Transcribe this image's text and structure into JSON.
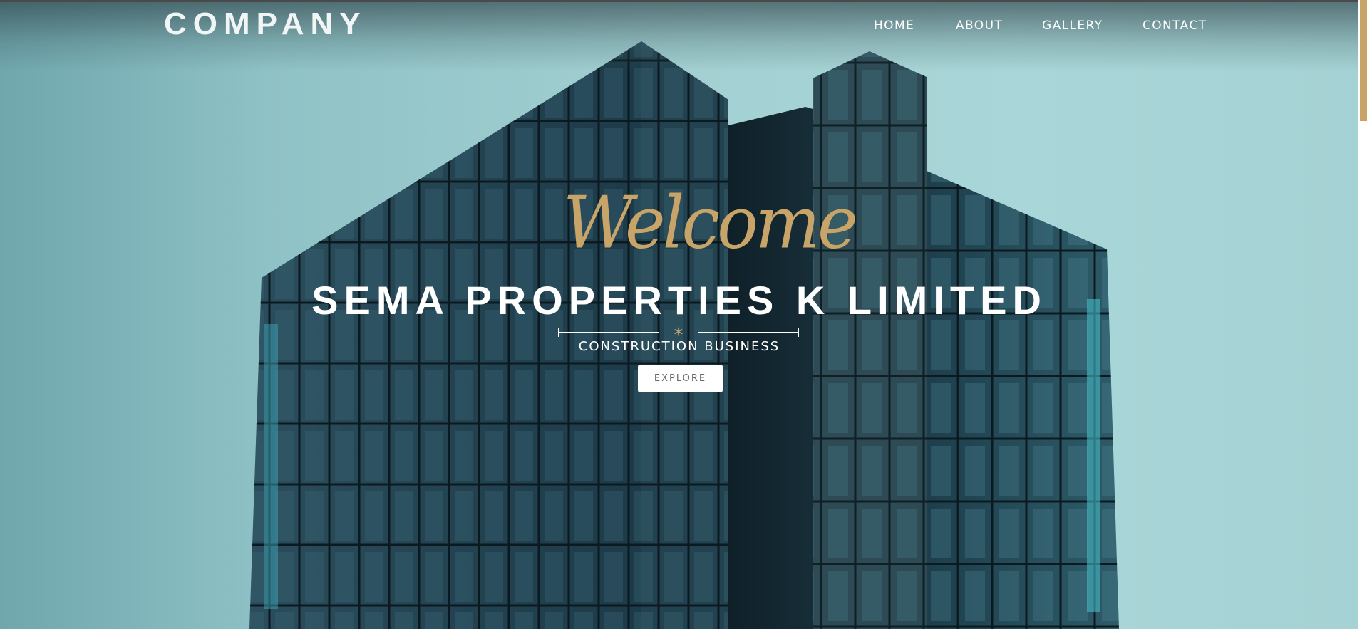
{
  "header": {
    "logo_text": "COMPANY",
    "nav": [
      {
        "label": "HOME"
      },
      {
        "label": "ABOUT"
      },
      {
        "label": "GALLERY"
      },
      {
        "label": "CONTACT"
      }
    ]
  },
  "hero": {
    "welcome": "Welcome",
    "title": "SEMA PROPERTIES K LIMITED",
    "divider_symbol": "*",
    "subtitle": "CONSTRUCTION BUSINESS",
    "cta_label": "EXPLORE"
  },
  "colors": {
    "accent_gold": "#c9a468",
    "sky_teal": "#a3d0d2",
    "building_dark": "#17323d",
    "text_white": "#ffffff"
  }
}
